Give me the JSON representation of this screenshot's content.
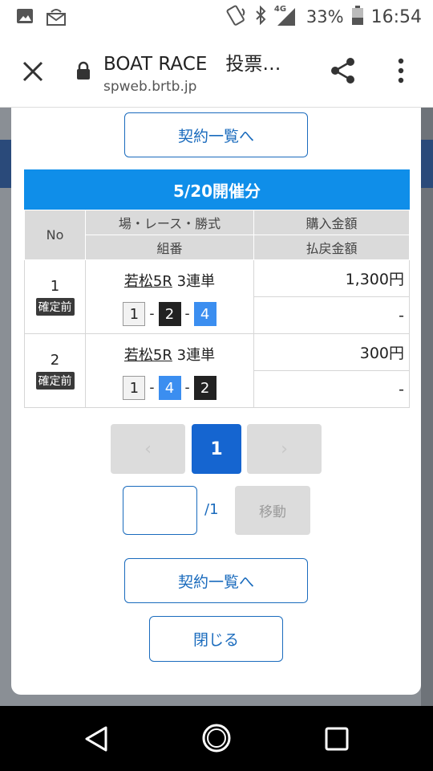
{
  "status_bar": {
    "network_label": "4G",
    "battery": "33%",
    "time": "16:54"
  },
  "browser": {
    "title": "BOAT RACE　投票…",
    "url": "spweb.brtb.jp"
  },
  "modal": {
    "top_button": "契約一覧へ",
    "header": "5/20開催分",
    "columns": {
      "no": "No",
      "race_info": "場・レース・勝式",
      "combination": "組番",
      "purchase_amount": "購入金額",
      "payout_amount": "払戻金額"
    },
    "rows": [
      {
        "no": "1",
        "status": "確定前",
        "place": "若松5R",
        "bet_type": "3連単",
        "combo": [
          "1",
          "2",
          "4"
        ],
        "purchase": "1,300円",
        "payout": "-"
      },
      {
        "no": "2",
        "status": "確定前",
        "place": "若松5R",
        "bet_type": "3連単",
        "combo": [
          "1",
          "4",
          "2"
        ],
        "purchase": "300円",
        "payout": "-"
      }
    ],
    "pagination": {
      "prev": "‹",
      "current": "1",
      "next": "›",
      "input_value": "",
      "total": "/1",
      "move": "移動"
    },
    "bottom_button": "契約一覧へ",
    "close_button": "閉じる"
  },
  "colors": {
    "accent": "#1565d0",
    "header_blue": "#0f8ee9",
    "boat_1": "#f2f2f2",
    "boat_2": "#222222",
    "boat_4": "#3b8ef0"
  }
}
